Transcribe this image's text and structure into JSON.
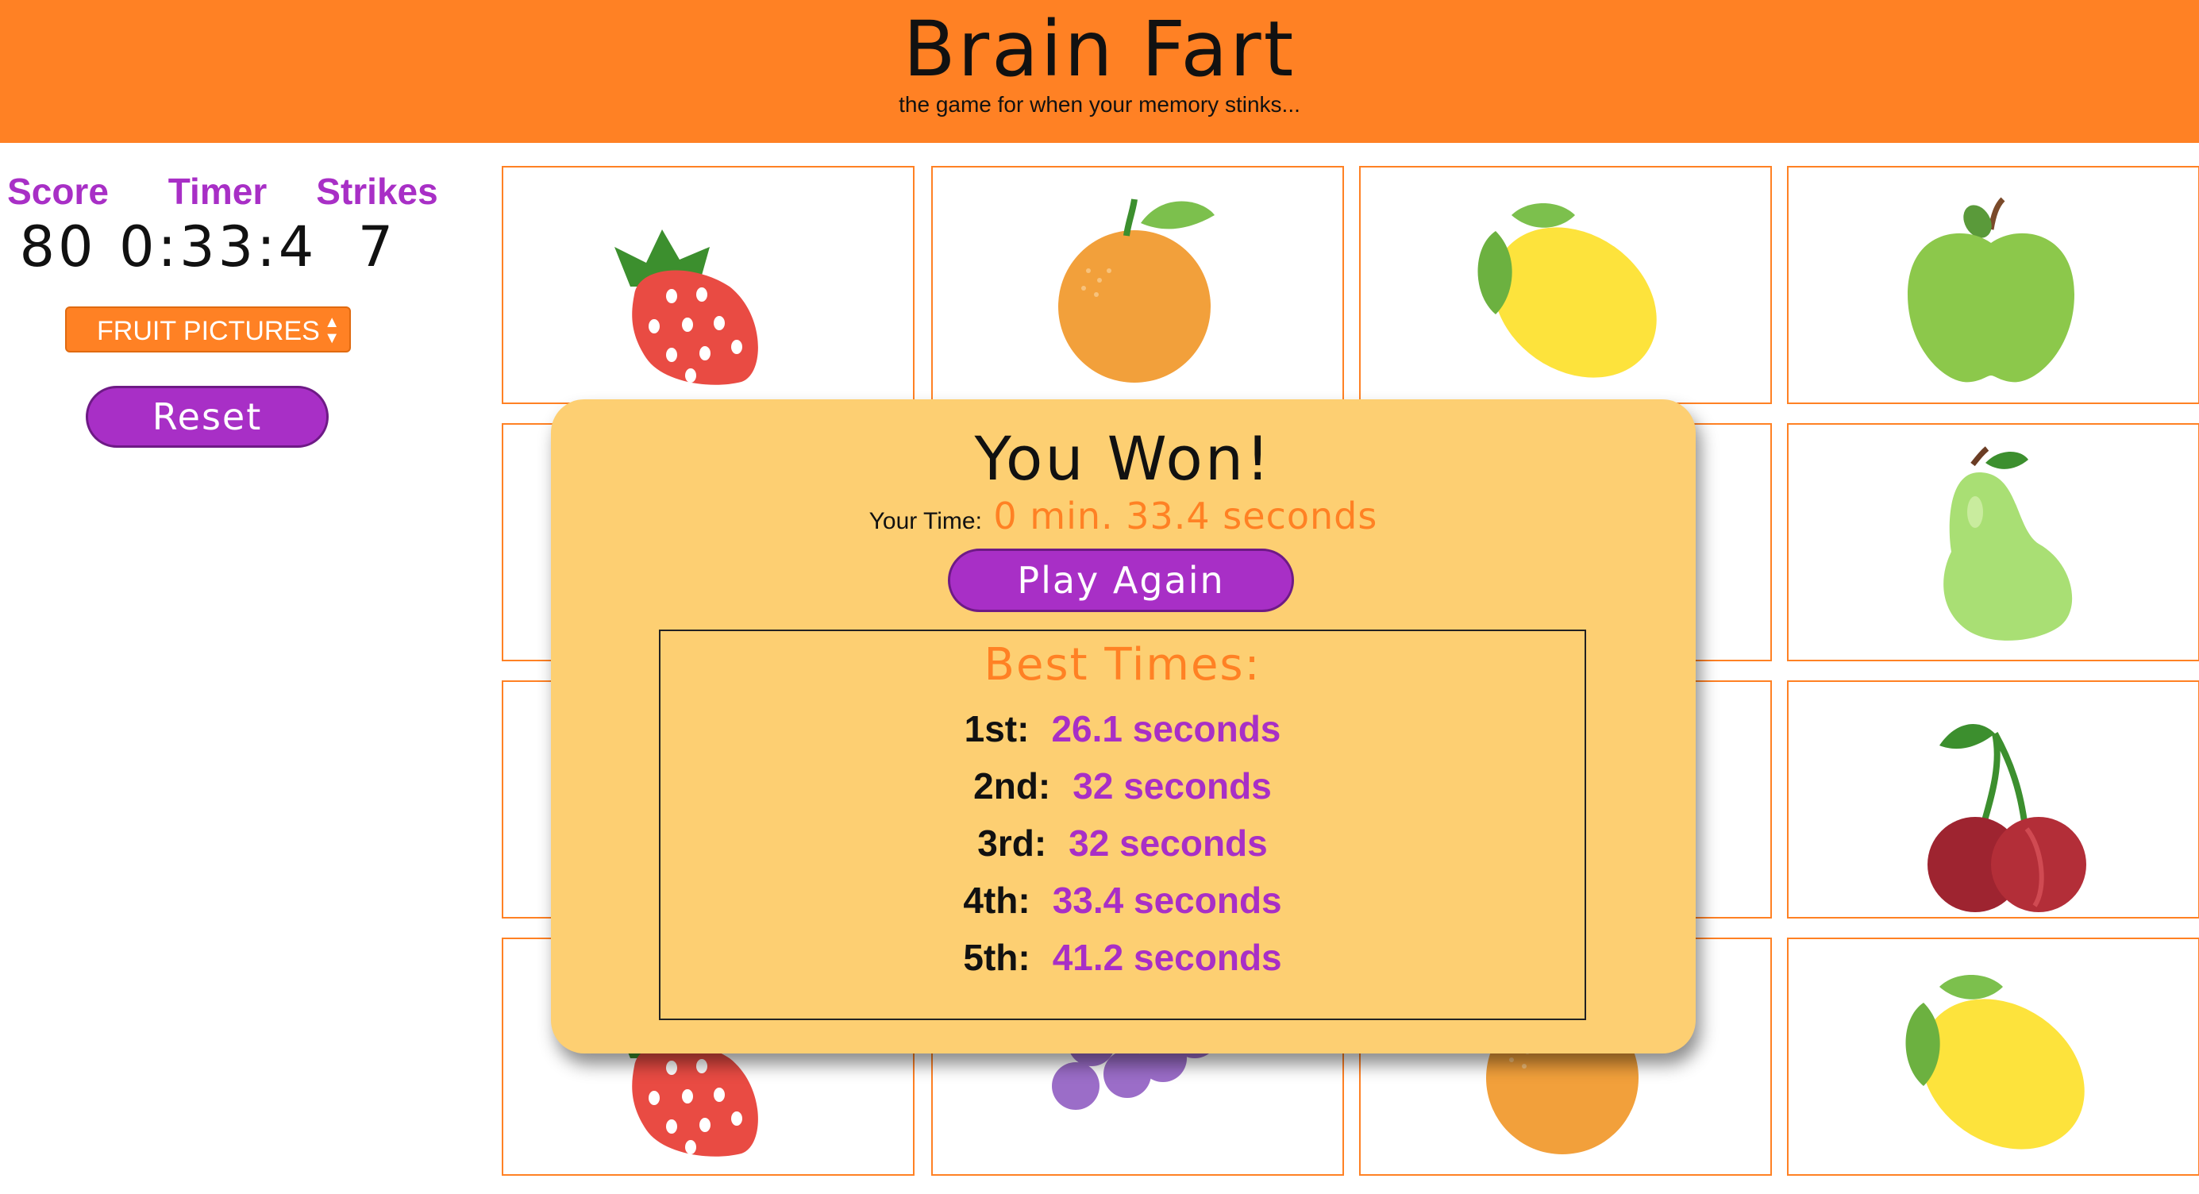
{
  "header": {
    "title": "Brain Fart",
    "subtitle": "the game for when your memory stinks..."
  },
  "stats": {
    "score_label": "Score",
    "score_value": "80",
    "timer_label": "Timer",
    "timer_value": "0:33:4",
    "strikes_label": "Strikes",
    "strikes_value": "7"
  },
  "controls": {
    "deck_select": "FRUIT PICTURES",
    "reset_label": "Reset"
  },
  "board": {
    "cards": [
      {
        "fruit": "strawberry-icon"
      },
      {
        "fruit": "orange-icon"
      },
      {
        "fruit": "lemon-icon"
      },
      {
        "fruit": "apple-icon"
      },
      {
        "fruit": "hidden"
      },
      {
        "fruit": "hidden"
      },
      {
        "fruit": "hidden"
      },
      {
        "fruit": "pear-icon"
      },
      {
        "fruit": "hidden"
      },
      {
        "fruit": "hidden"
      },
      {
        "fruit": "hidden"
      },
      {
        "fruit": "cherry-icon"
      },
      {
        "fruit": "strawberry-icon"
      },
      {
        "fruit": "grapes-icon"
      },
      {
        "fruit": "orange-icon"
      },
      {
        "fruit": "lemon-icon"
      }
    ]
  },
  "modal": {
    "heading": "You Won!",
    "your_time_label": "Your Time:",
    "your_time_value": "0 min. 33.4 seconds",
    "play_again_label": "Play Again",
    "best_times_title": "Best Times:",
    "best_times": [
      {
        "rank": "1st:",
        "time": "26.1 seconds"
      },
      {
        "rank": "2nd:",
        "time": "32 seconds"
      },
      {
        "rank": "3rd:",
        "time": "32 seconds"
      },
      {
        "rank": "4th:",
        "time": "33.4 seconds"
      },
      {
        "rank": "5th:",
        "time": "41.2 seconds"
      }
    ]
  },
  "colors": {
    "header": "#ff8124",
    "accent_purple": "#a82fc6",
    "modal_bg": "#fdcf72"
  }
}
